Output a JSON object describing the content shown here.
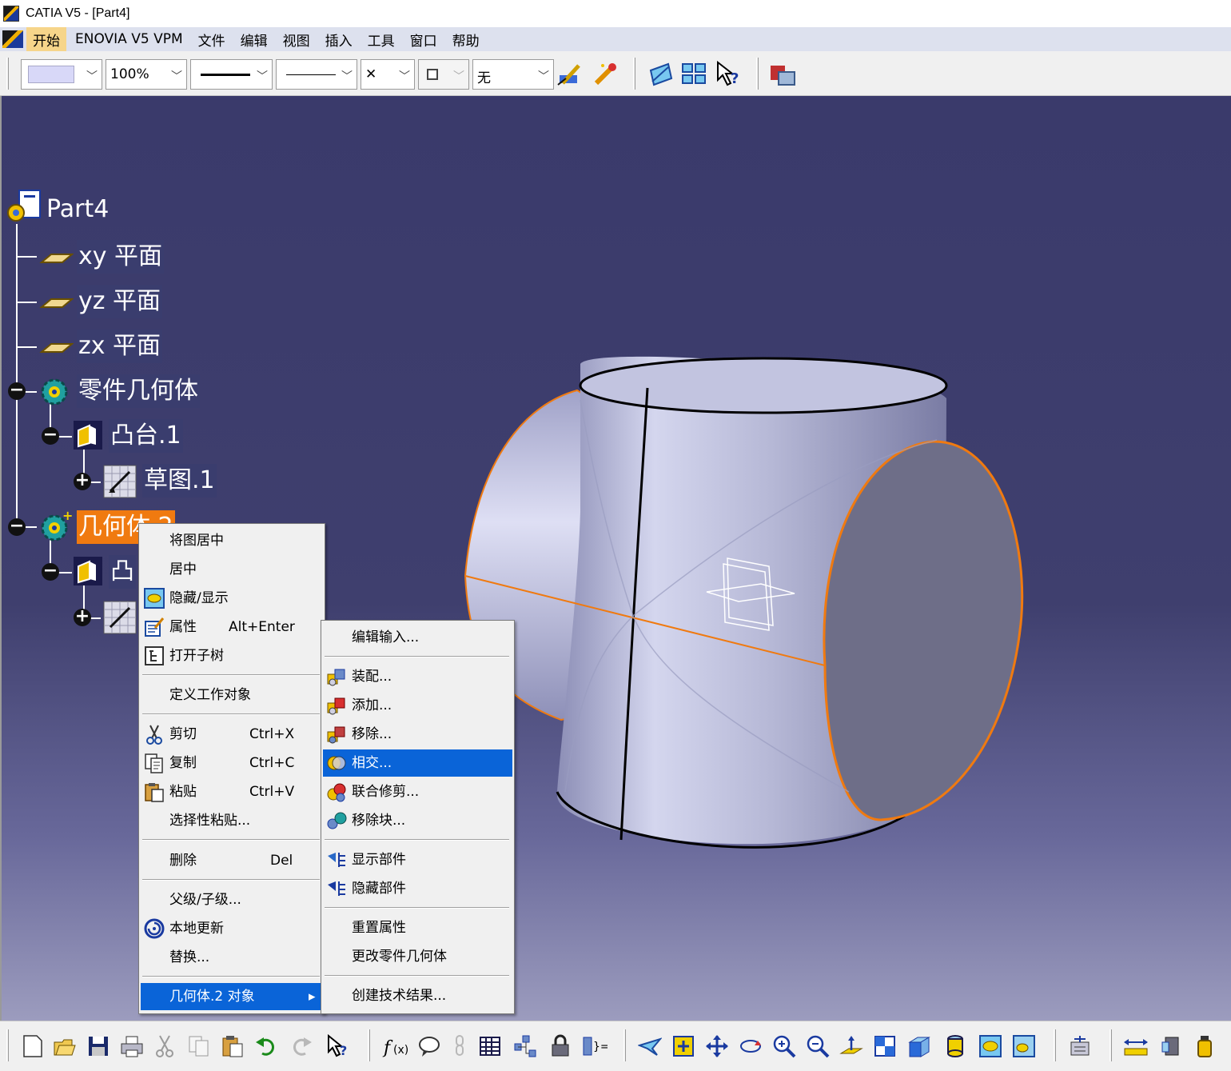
{
  "window": {
    "title": "CATIA V5 - [Part4]"
  },
  "menubar": {
    "items": [
      "开始",
      "ENOVIA V5 VPM",
      "文件",
      "编辑",
      "视图",
      "插入",
      "工具",
      "窗口",
      "帮助"
    ]
  },
  "toolbar_top": {
    "color_value": "",
    "transparency_value": "100%",
    "line_type_value": "",
    "line_weight_value": "",
    "point_symbol_value": "✕",
    "layer_value": "无",
    "icons": [
      "painter-icon",
      "properties-wand-icon",
      "flat-view-icon",
      "multi-view-icon",
      "whats-this-icon",
      "catalog-icon"
    ]
  },
  "tree": {
    "root": "Part4",
    "xy_plane": "xy 平面",
    "yz_plane": "yz 平面",
    "zx_plane": "zx 平面",
    "part_body": "零件几何体",
    "pad1": "凸台.1",
    "sketch1": "草图.1",
    "body2": "几何体.2",
    "pad2_partial": "凸"
  },
  "context_menu": {
    "center_graph": "将图居中",
    "center": "居中",
    "hide_show": "隐藏/显示",
    "properties": "属性",
    "properties_shortcut": "Alt+Enter",
    "open_subtree": "打开子树",
    "define_work_object": "定义工作对象",
    "cut": "剪切",
    "cut_shortcut": "Ctrl+X",
    "copy": "复制",
    "copy_shortcut": "Ctrl+C",
    "paste": "粘贴",
    "paste_shortcut": "Ctrl+V",
    "paste_special": "选择性粘贴...",
    "delete": "删除",
    "delete_shortcut": "Del",
    "parents_children": "父级/子级...",
    "local_update": "本地更新",
    "replace": "替换...",
    "object_submenu": "几何体.2 对象",
    "submenu_arrow": "▸"
  },
  "submenu": {
    "edit_inputs": "编辑输入...",
    "assemble": "装配...",
    "add": "添加...",
    "remove": "移除...",
    "intersect": "相交...",
    "union_trim": "联合修剪...",
    "remove_lump": "移除块...",
    "show_components": "显示部件",
    "hide_components": "隐藏部件",
    "reset_properties": "重置属性",
    "change_part_body": "更改零件几何体",
    "create_technological_results": "创建技术结果..."
  },
  "colors": {
    "viewport_top": "#3a3a6b",
    "viewport_bottom": "#9c9cbe",
    "selection_orange": "#f07a10",
    "menu_highlight": "#0a64d8",
    "model_surface": "#b8bad8"
  },
  "toolbar_bottom": {
    "icons": [
      "new-icon",
      "open-icon",
      "save-icon",
      "print-icon",
      "cut-icon",
      "copy-icon",
      "paste-icon",
      "undo-icon",
      "redo-icon",
      "whats-this-icon",
      "formula-icon",
      "comment-icon",
      "link-icon",
      "table-icon",
      "knowledge-icon",
      "lock-icon",
      "parameter-icon",
      "fly-mode-icon",
      "fit-all-icon",
      "pan-icon",
      "rotate-icon",
      "zoom-in-icon",
      "zoom-out-icon",
      "normal-view-icon",
      "quick-view-icon",
      "iso-view-icon",
      "shading-icon",
      "hide-show-icon",
      "swap-visible-icon",
      "catalog-icon",
      "measure-icon",
      "inertia-icon",
      "material-icon"
    ]
  }
}
